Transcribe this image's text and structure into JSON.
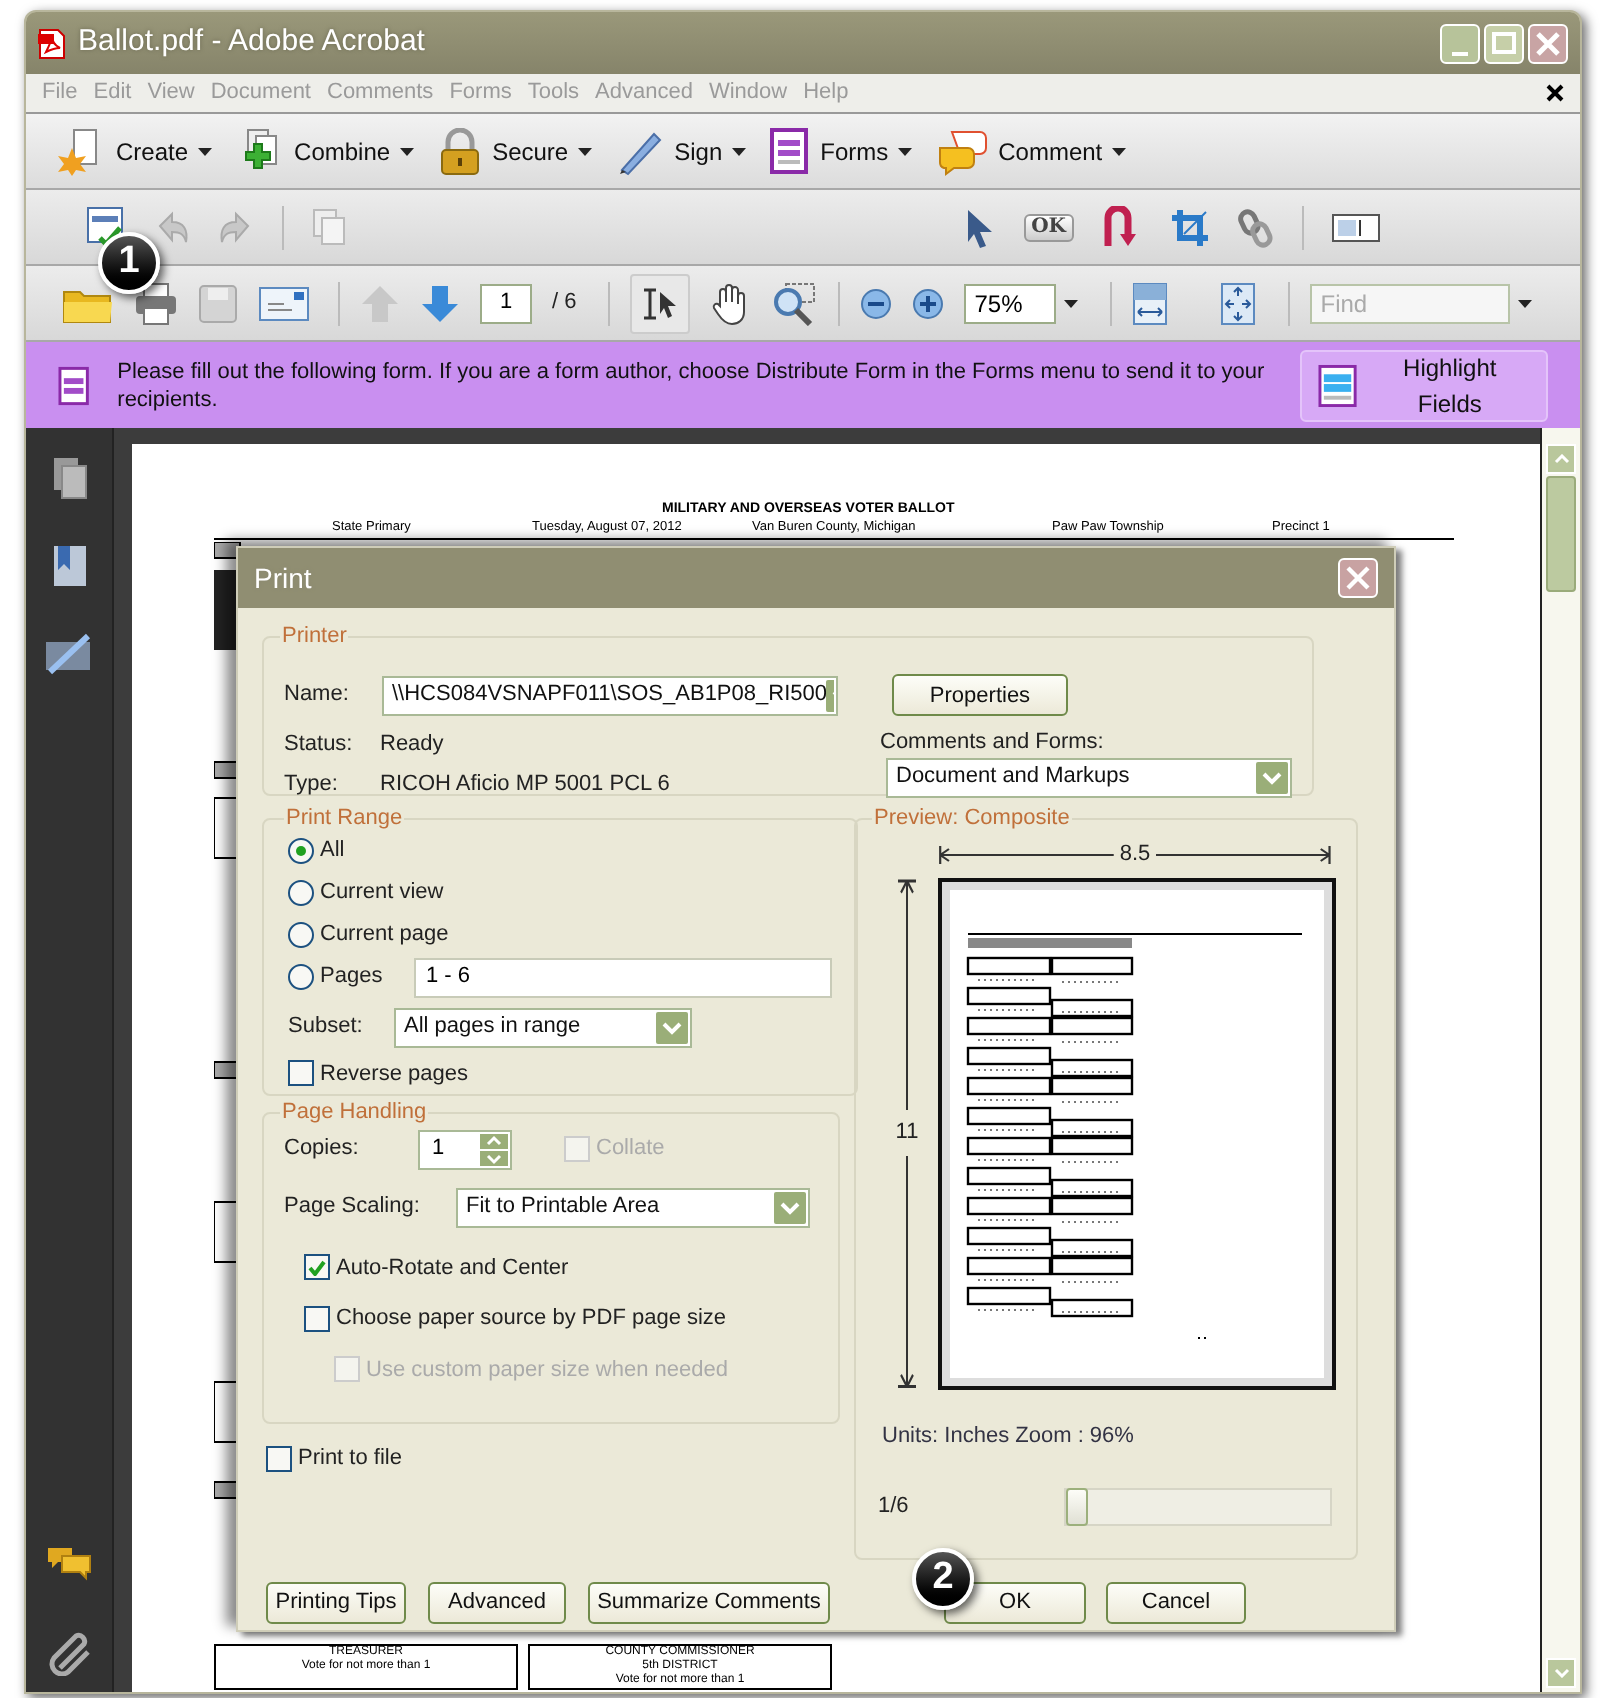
{
  "window": {
    "title": "Ballot.pdf - Adobe Acrobat"
  },
  "menu": [
    {
      "label": "File"
    },
    {
      "label": "Edit"
    },
    {
      "label": "View"
    },
    {
      "label": "Document"
    },
    {
      "label": "Comments"
    },
    {
      "label": "Forms"
    },
    {
      "label": "Tools"
    },
    {
      "label": "Advanced"
    },
    {
      "label": "Window"
    },
    {
      "label": "Help"
    }
  ],
  "task_toolbar": [
    {
      "kind": "create",
      "label": "Create"
    },
    {
      "kind": "combine",
      "label": "Combine"
    },
    {
      "kind": "secure",
      "label": "Secure"
    },
    {
      "kind": "sign",
      "label": "Sign"
    },
    {
      "kind": "forms",
      "label": "Forms"
    },
    {
      "kind": "comment",
      "label": "Comment"
    }
  ],
  "edit_toolbar": {
    "button_tool": "OK"
  },
  "nav_toolbar": {
    "page": "1",
    "page_total": "/ 6",
    "zoom": "75%",
    "find_placeholder": "Find"
  },
  "form_bar": {
    "message": "Please fill out the following form. If you are a form author, choose Distribute Form in the Forms menu to send it to your recipients.",
    "button": "Highlight Fields"
  },
  "document": {
    "title": "MILITARY AND OVERSEAS VOTER BALLOT",
    "header": [
      "State Primary",
      "Tuesday, August 07, 2012",
      "Van Buren County, Michigan",
      "Paw Paw Township",
      "Precinct 1"
    ],
    "offices": [
      {
        "lines": [
          "TREASURER",
          "Vote for not more than 1"
        ]
      },
      {
        "lines": [
          "COUNTY COMMISSIONER",
          "5th DISTRICT",
          "Vote for not more than 1"
        ]
      }
    ]
  },
  "print_dialog": {
    "title": "Print",
    "printer": {
      "legend": "Printer",
      "name_label": "Name:",
      "name_value": "\\\\HCS084VSNAPF011\\SOS_AB1P08_RI500",
      "status_label": "Status:",
      "status_value": "Ready",
      "type_label": "Type:",
      "type_value": "RICOH Aficio MP 5001 PCL 6",
      "properties_button": "Properties",
      "comments_label": "Comments and Forms:",
      "comments_value": "Document and Markups"
    },
    "print_range": {
      "legend": "Print Range",
      "options": [
        {
          "label": "All",
          "selected": true
        },
        {
          "label": "Current view",
          "selected": false
        },
        {
          "label": "Current page",
          "selected": false
        },
        {
          "label": "Pages",
          "selected": false
        }
      ],
      "pages_value": "1 - 6",
      "subset_label": "Subset:",
      "subset_value": "All pages in range",
      "reverse": {
        "label": "Reverse pages",
        "checked": false
      }
    },
    "page_handling": {
      "legend": "Page Handling",
      "copies_label": "Copies:",
      "copies_value": "1",
      "collate": {
        "label": "Collate",
        "checked": false,
        "disabled": true
      },
      "scaling_label": "Page Scaling:",
      "scaling_value": "Fit to Printable Area",
      "options": [
        {
          "label": "Auto-Rotate and Center",
          "checked": true,
          "disabled": false
        },
        {
          "label": "Choose paper source by PDF page size",
          "checked": false,
          "disabled": false,
          "children": [
            {
              "label": "Use custom paper size when needed",
              "checked": false,
              "disabled": true
            }
          ]
        }
      ]
    },
    "print_to_file": {
      "label": "Print to file",
      "checked": false
    },
    "preview": {
      "legend": "Preview: Composite",
      "width_label": "8.5",
      "height_label": "11",
      "units": "Units: Inches Zoom :  96%",
      "page": "1/6",
      "level": 0
    },
    "buttons": [
      "Printing Tips",
      "Advanced",
      "Summarize Comments"
    ],
    "ok": "OK",
    "cancel": "Cancel"
  },
  "callouts": [
    "1",
    "2"
  ]
}
